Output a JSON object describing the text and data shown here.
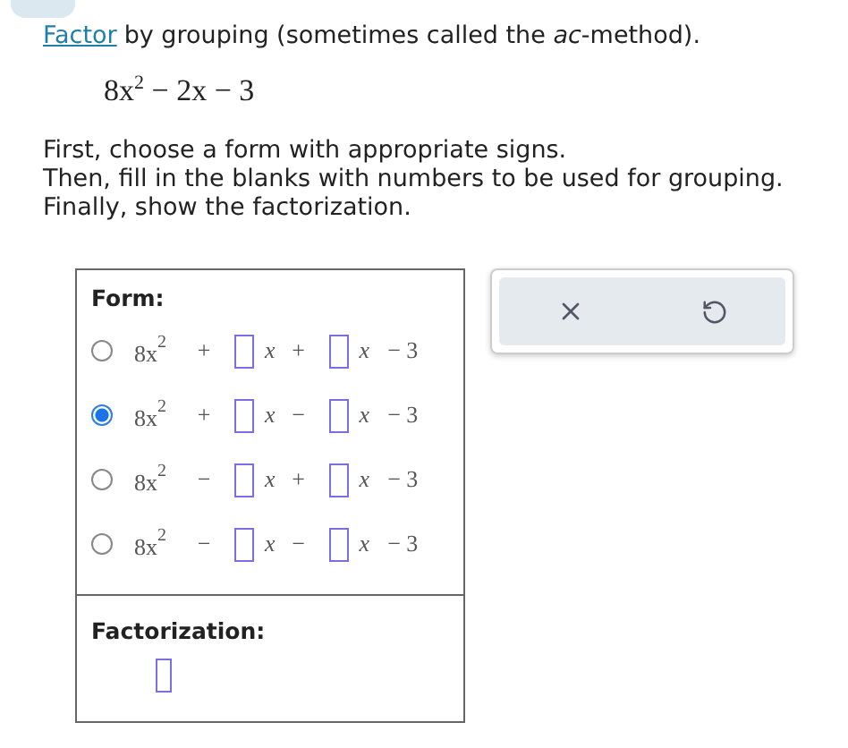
{
  "intro": {
    "link": "Factor",
    "text": "by grouping (sometimes called the *ac*-method)."
  },
  "expression": "8x$^{2}$ − 2x − 3",
  "instructions": [
    "First, choose a form with appropriate signs.",
    "Then, fill in the blanks with numbers to be used for grouping.",
    "Finally, show the factorization."
  ],
  "form": {
    "label": "Form:",
    "options": [
      {
        "selected": false,
        "lead": "8x$^{2}$",
        "sign_1": "+",
        "var_1": "x",
        "sign_2": "+",
        "var_2": "x",
        "tail": "− 3"
      },
      {
        "selected": true,
        "lead": "8x$^{2}$",
        "sign_1": "+",
        "var_1": "x",
        "sign_2": "−",
        "var_2": "x",
        "tail": "− 3"
      },
      {
        "selected": false,
        "lead": "8x$^{2}$",
        "sign_1": "−",
        "var_1": "x",
        "sign_2": "+",
        "var_2": "x",
        "tail": "− 3"
      },
      {
        "selected": false,
        "lead": "8x$^{2}$",
        "sign_1": "−",
        "var_1": "x",
        "sign_2": "−",
        "var_2": "x",
        "tail": "− 3"
      }
    ]
  },
  "factorization": {
    "label": "Factorization:"
  }
}
